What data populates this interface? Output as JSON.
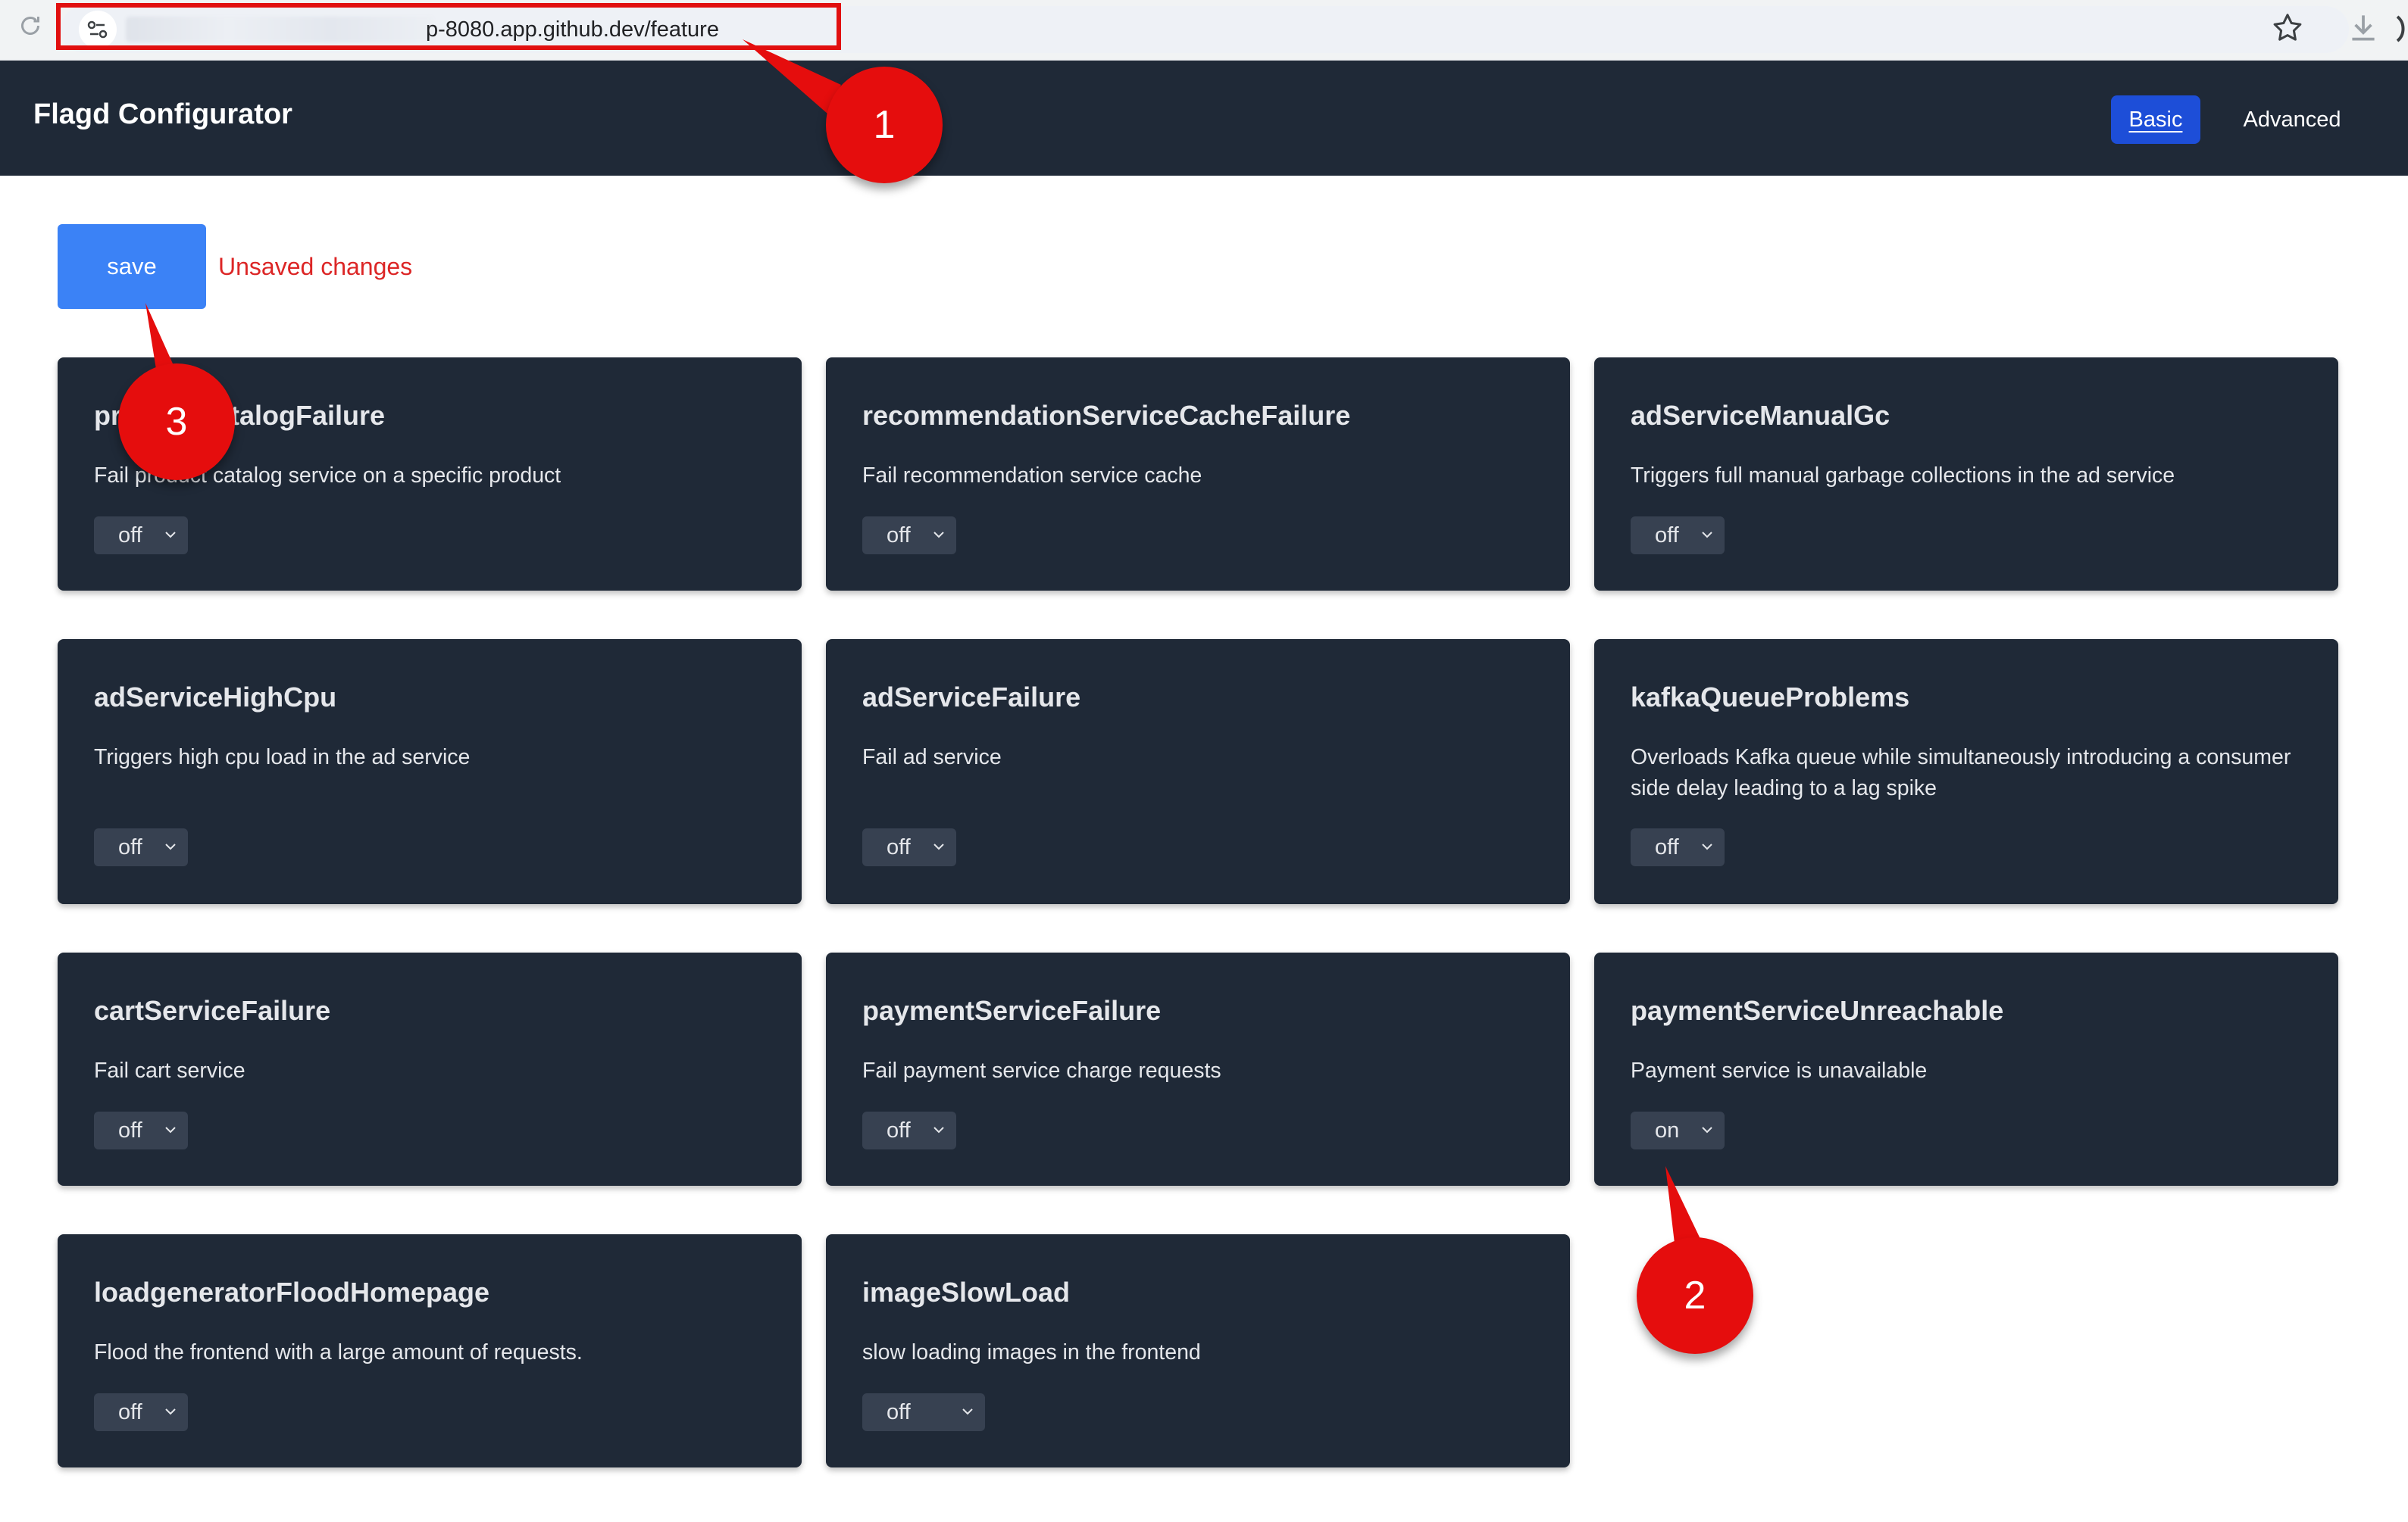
{
  "browser": {
    "url_visible": "p-8080.app.github.dev/feature"
  },
  "header": {
    "title": "Flagd Configurator",
    "tabs": [
      {
        "label": "Basic",
        "active": true
      },
      {
        "label": "Advanced",
        "active": false
      }
    ]
  },
  "toolbar": {
    "save_label": "save",
    "status_text": "Unsaved changes"
  },
  "flags": [
    {
      "name": "productCatalogFailure",
      "description": "Fail product catalog service on a specific product",
      "value": "off"
    },
    {
      "name": "recommendationServiceCacheFailure",
      "description": "Fail recommendation service cache",
      "value": "off"
    },
    {
      "name": "adServiceManualGc",
      "description": "Triggers full manual garbage collections in the ad service",
      "value": "off"
    },
    {
      "name": "adServiceHighCpu",
      "description": "Triggers high cpu load in the ad service",
      "value": "off"
    },
    {
      "name": "adServiceFailure",
      "description": "Fail ad service",
      "value": "off"
    },
    {
      "name": "kafkaQueueProblems",
      "description": "Overloads Kafka queue while simultaneously introducing a consumer side delay leading to a lag spike",
      "value": "off"
    },
    {
      "name": "cartServiceFailure",
      "description": "Fail cart service",
      "value": "off"
    },
    {
      "name": "paymentServiceFailure",
      "description": "Fail payment service charge requests",
      "value": "off"
    },
    {
      "name": "paymentServiceUnreachable",
      "description": "Payment service is unavailable",
      "value": "on"
    },
    {
      "name": "loadgeneratorFloodHomepage",
      "description": "Flood the frontend with a large amount of requests.",
      "value": "off"
    },
    {
      "name": "imageSlowLoad",
      "description": "slow loading images in the frontend",
      "value": "off"
    }
  ],
  "annotations": {
    "badge_1": "1",
    "badge_2": "2",
    "badge_3": "3",
    "color": "#e50d0d"
  },
  "colors": {
    "header_bg": "#1f2937",
    "card_bg": "#1f2937",
    "select_bg": "#374151",
    "save_button": "#3b82f6",
    "active_tab": "#1d4ed8",
    "unsaved_text": "#dc2626"
  },
  "icons": [
    "reload-icon",
    "site-info-icon",
    "star-icon",
    "download-icon",
    "chevron-down-icon"
  ]
}
